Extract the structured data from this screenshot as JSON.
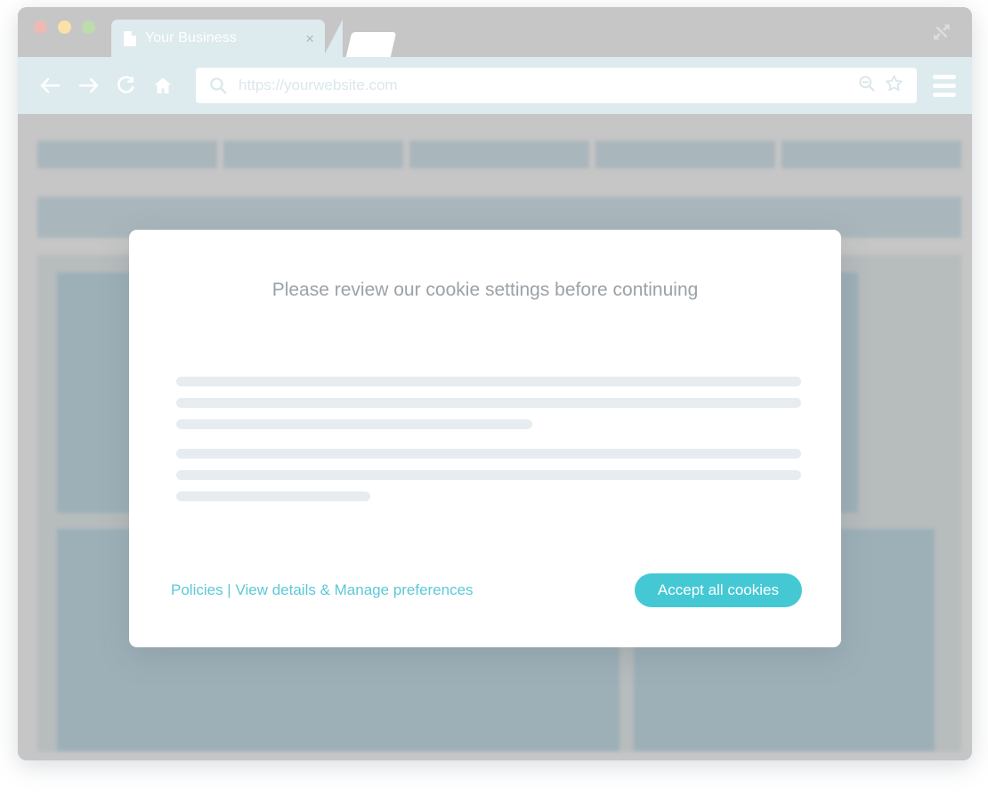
{
  "window": {
    "traffic_lights": [
      {
        "name": "close",
        "color": "#eeb9b4"
      },
      {
        "name": "minimize",
        "color": "#fbe0a8"
      },
      {
        "name": "maximize",
        "color": "#bcdcac"
      }
    ],
    "expand_icon": "expand-diagonal-icon"
  },
  "tabs": [
    {
      "title": "Your Business",
      "favicon": "document-icon",
      "close": "×",
      "active": true
    },
    {
      "title": "",
      "active": false
    }
  ],
  "toolbar": {
    "back_icon": "arrow-left-icon",
    "forward_icon": "arrow-right-icon",
    "reload_icon": "reload-icon",
    "home_icon": "home-icon",
    "search_icon": "search-icon",
    "zoom_out_icon": "zoom-out-icon",
    "bookmark_icon": "star-icon",
    "menu_icon": "hamburger-menu-icon",
    "address": {
      "value": "https://yourwebsite.com",
      "placeholder": "https://yourwebsite.com"
    }
  },
  "page": {
    "nav_placeholder_count": 5,
    "colors": {
      "chrome": "#c6c6c6",
      "toolbar": "#ddeaee",
      "page_bg": "#c6c6c6",
      "frame": "#b7bcbd",
      "block": "#9db0b8",
      "nav_block": "#a9b6bc"
    }
  },
  "modal": {
    "title": "Please review our cookie settings before continuing",
    "skeleton_groups": [
      {
        "lines": [
          {
            "width": "100%"
          },
          {
            "width": "100%"
          },
          {
            "width": "57%"
          }
        ]
      },
      {
        "lines": [
          {
            "width": "100%"
          },
          {
            "width": "100%"
          },
          {
            "width": "31%"
          }
        ]
      }
    ],
    "policy_link": "Policies | View details & Manage preferences",
    "accept_label": "Accept all cookies",
    "accent_color": "#44c8d4",
    "link_color": "#5cc8d8",
    "title_color": "#9ba2a7"
  }
}
